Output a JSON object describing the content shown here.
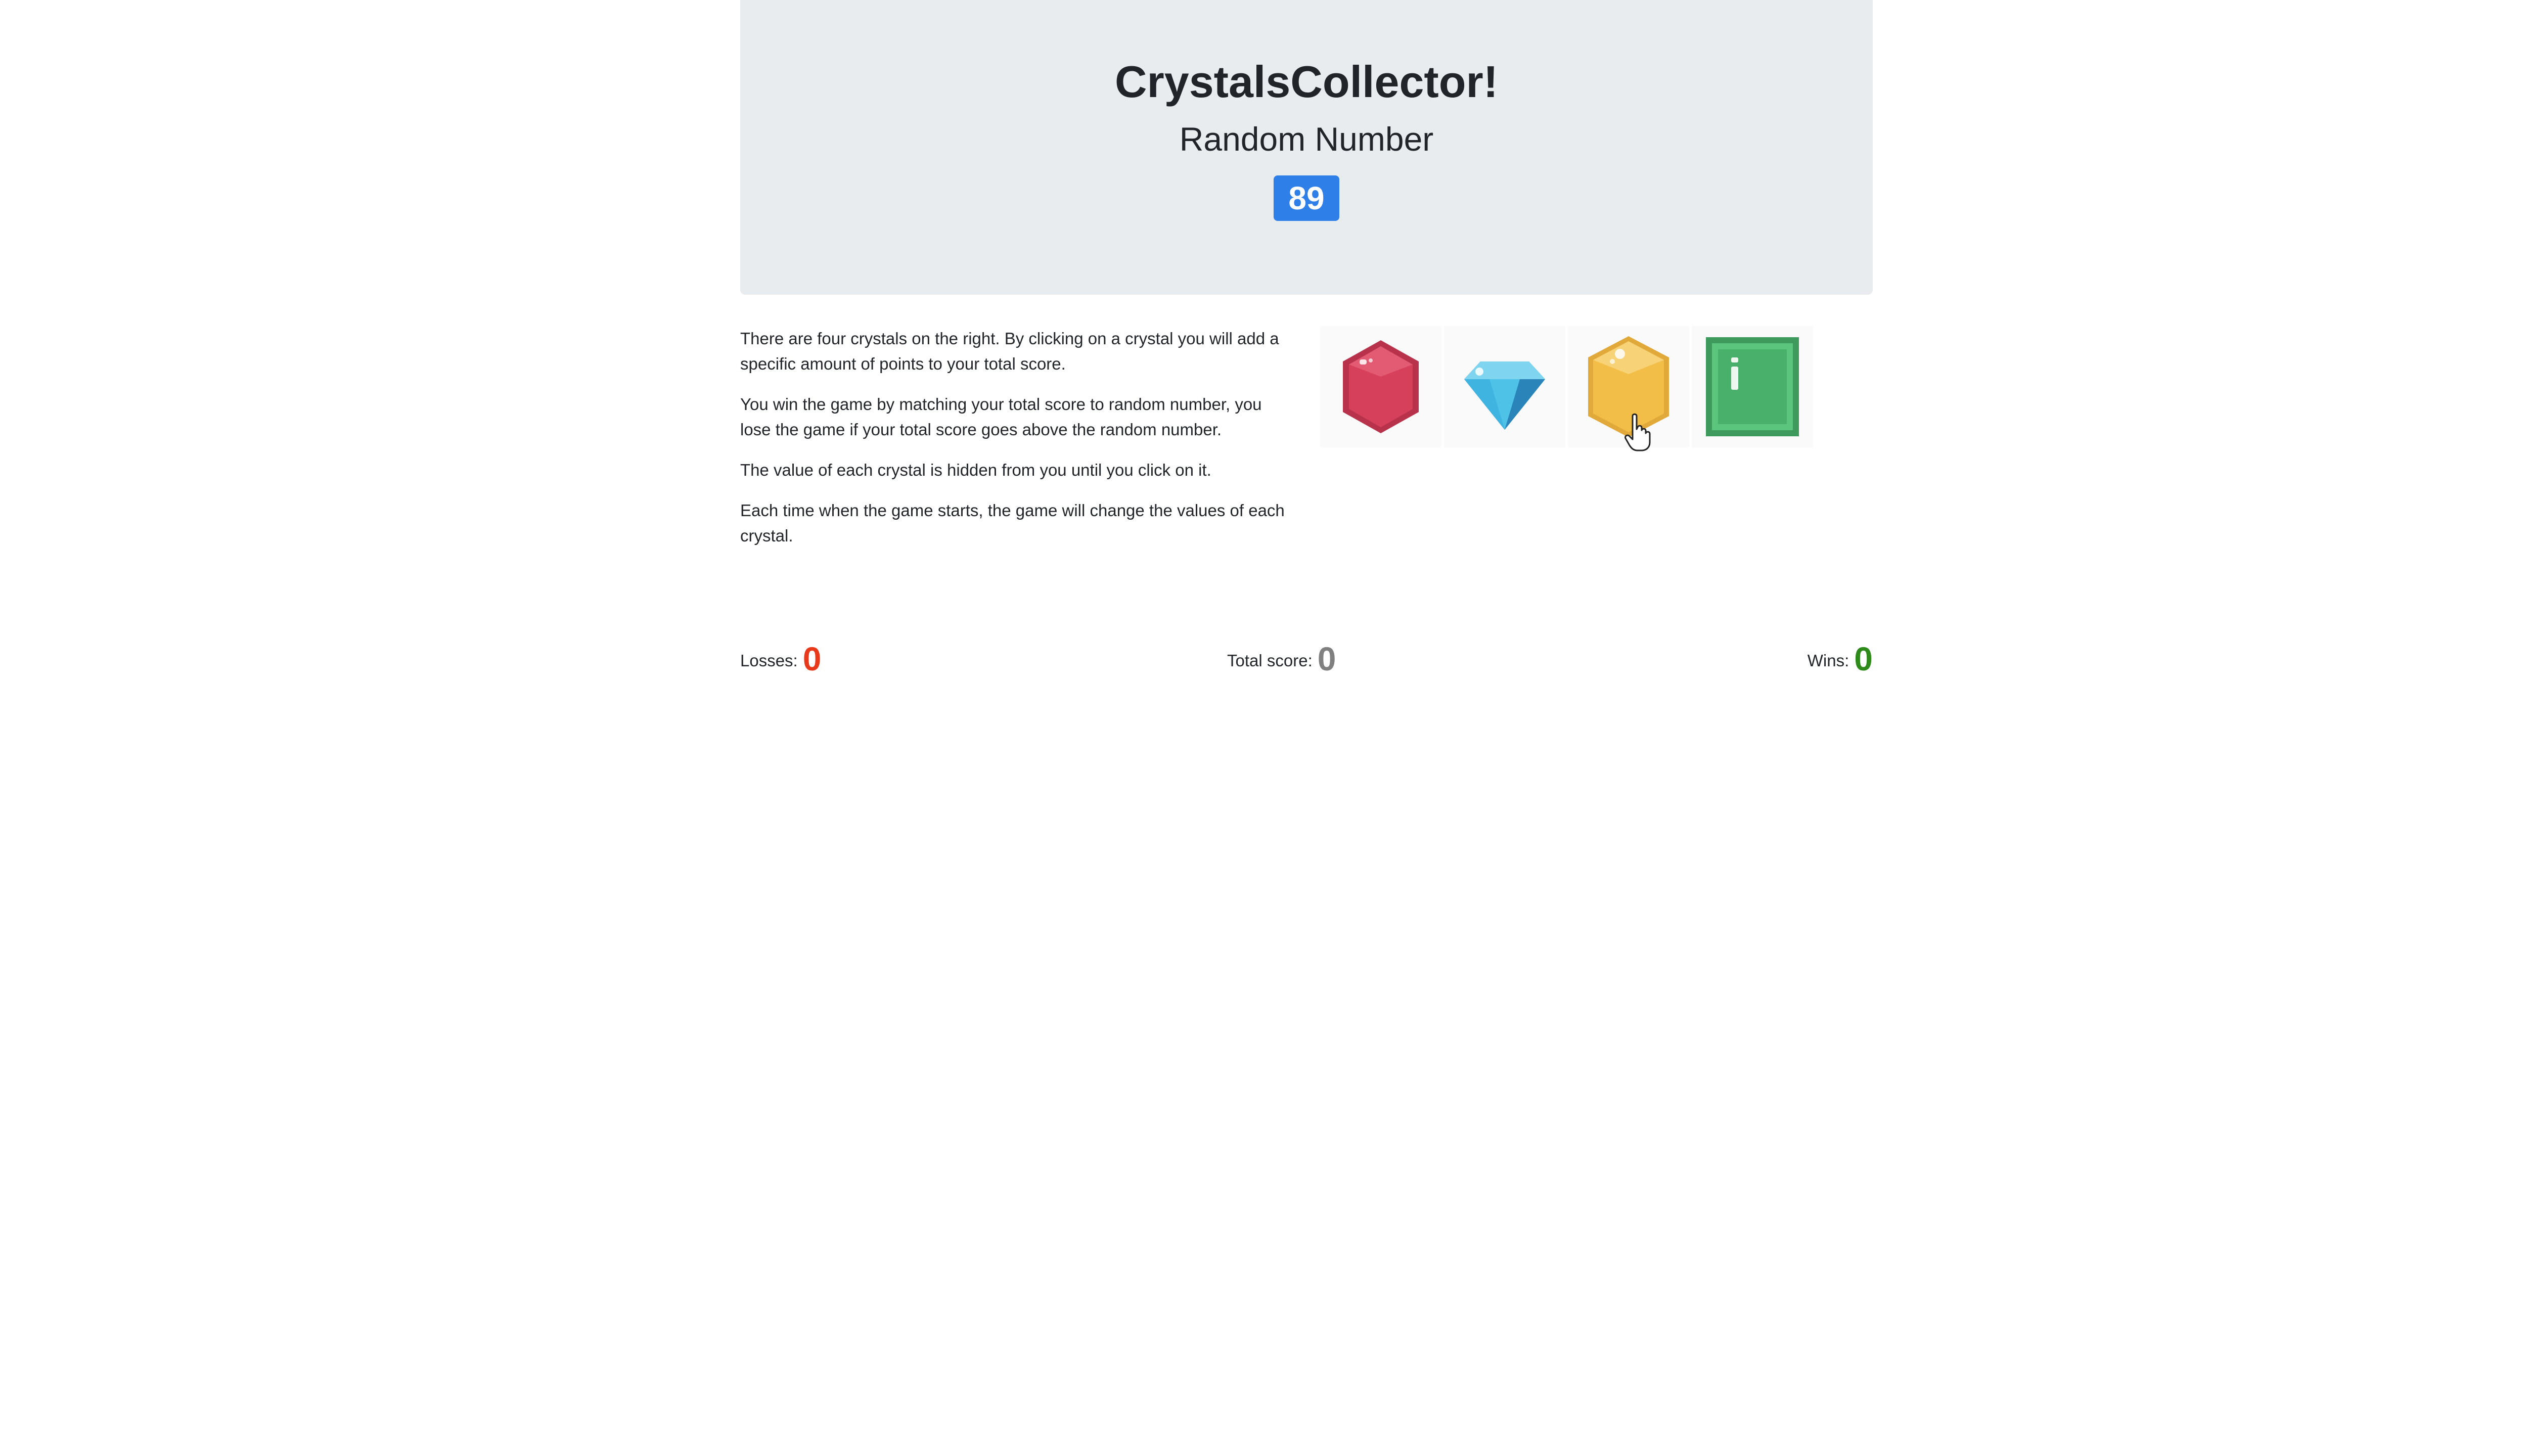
{
  "header": {
    "title": "CrystalsCollector!",
    "subtitle": "Random Number",
    "random_number": "89"
  },
  "instructions": [
    "There are four crystals on the right. By clicking on a crystal you will add a specific amount of points to your total score.",
    "You win the game by matching your total score to random number, you lose the game if your total score goes above the random number.",
    "The value of each crystal is hidden from you until you click on it.",
    "Each time when the game starts, the game will change the values of each crystal."
  ],
  "crystals": [
    {
      "icon": "red-gem-icon",
      "color": "#d6405b"
    },
    {
      "icon": "blue-diamond-icon",
      "color": "#3fb4e0"
    },
    {
      "icon": "yellow-gem-icon",
      "color": "#f2be48"
    },
    {
      "icon": "green-gem-icon",
      "color": "#5cc57d"
    }
  ],
  "scores": {
    "losses_label": "Losses:",
    "losses_value": "0",
    "total_label": "Total score:",
    "total_value": "0",
    "wins_label": "Wins:",
    "wins_value": "0"
  },
  "colors": {
    "badge": "#2f7fe8",
    "losses": "#e8391a",
    "total": "#808080",
    "wins": "#2f8a1c",
    "jumbotron": "#e9ecef"
  }
}
